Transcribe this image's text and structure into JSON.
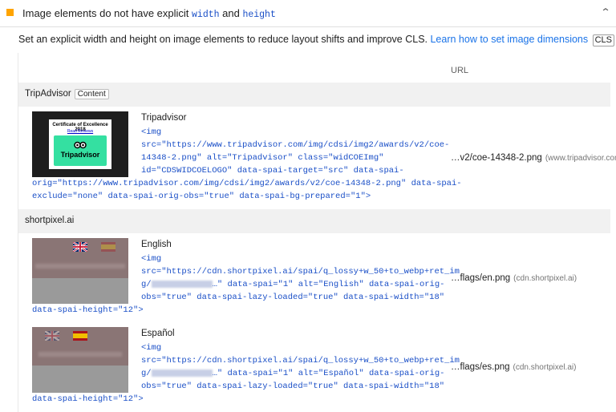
{
  "audit": {
    "title_pre": "Image elements do not have explicit ",
    "title_code1": "width",
    "title_and": " and ",
    "title_code2": "height",
    "description": "Set an explicit width and height on image elements to reduce layout shifts and improve CLS. ",
    "learn_link": "Learn how to set image dimensions",
    "cls_tag": "CLS",
    "url_column": "URL",
    "colors": {
      "warning": "#ffa400",
      "link": "#1a73e8",
      "code": "#1a4fc7",
      "group_bg": "#f1f1f1"
    }
  },
  "groups": [
    {
      "title": "TripAdvisor",
      "tag": "Content",
      "items": [
        {
          "label": "Tripadvisor",
          "code_lines": [
            "<img",
            "src=\"https://www.tripadvisor.com/img/cdsi/img2/awards/v2/coe-",
            "14348-2.png\" alt=\"Tripadvisor\" class=\"widCOEImg\"",
            "id=\"CDSWIDCOELOGO\" data-spai-target=\"src\" data-spai-",
            "orig=\"https://www.tripadvisor.com/img/cdsi/img2/awards/v2/coe-14348-2.png\" data-spai-",
            "exclude=\"none\" data-spai-orig-obs=\"true\" data-spai-bg-prepared=\"1\">"
          ],
          "url": "…v2/coe-14348-2.png",
          "host": "(www.tripadvisor.com)",
          "thumb": {
            "line1": "Certificate of Excellence 2018",
            "line2": "Read Reviews",
            "brand": "Tripadvisor",
            "icon": "owl-icon"
          }
        }
      ]
    },
    {
      "title": "shortpixel.ai",
      "items": [
        {
          "label": "English",
          "code_lines": [
            "<img",
            "src=\"https://cdn.shortpixel.ai/spai/q_lossy+w_50+to_webp+ret_im",
            "…\" data-spai=\"1\" alt=\"English\" data-spai-orig-",
            "obs=\"true\" data-spai-lazy-loaded=\"true\" data-spai-width=\"18\"",
            "data-spai-height=\"12\">"
          ],
          "code_prefix": "g/",
          "url": "…flags/en.png",
          "host": "(cdn.shortpixel.ai)",
          "thumb": {
            "icon": "uk-flag-icon"
          }
        },
        {
          "label": "Español",
          "code_lines": [
            "<img",
            "src=\"https://cdn.shortpixel.ai/spai/q_lossy+w_50+to_webp+ret_im",
            "…\" data-spai=\"1\" alt=\"Español\" data-spai-orig-",
            "obs=\"true\" data-spai-lazy-loaded=\"true\" data-spai-width=\"18\"",
            "data-spai-height=\"12\">"
          ],
          "code_prefix": "g/",
          "url": "…flags/es.png",
          "host": "(cdn.shortpixel.ai)",
          "thumb": {
            "icon": "spain-flag-icon"
          }
        }
      ]
    }
  ]
}
